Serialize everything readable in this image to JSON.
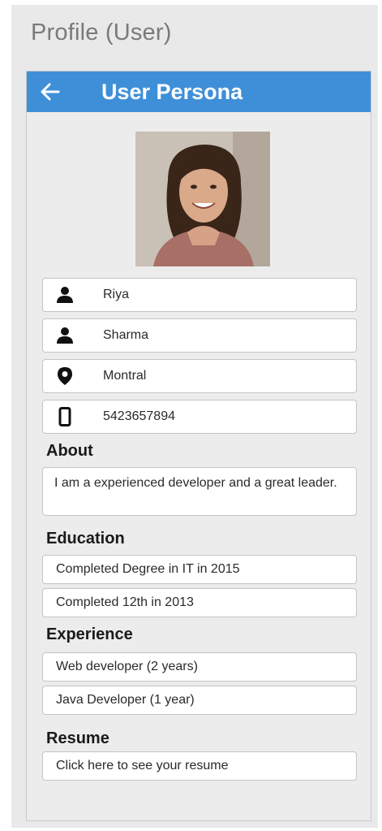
{
  "window": {
    "title": "Profile (User)"
  },
  "appbar": {
    "title": "User Persona",
    "back_icon": "arrow-left-icon"
  },
  "profile": {
    "photo_icon": "user-photo",
    "first_name": "Riya",
    "last_name": "Sharma",
    "location": "Montral",
    "phone": "5423657894"
  },
  "about": {
    "heading": "About",
    "text": "I am a experienced developer and a great leader."
  },
  "education": {
    "heading": "Education",
    "items": [
      "Completed Degree in IT in 2015",
      "Completed 12th in 2013"
    ]
  },
  "experience": {
    "heading": "Experience",
    "items": [
      "Web developer (2 years)",
      "Java Developer (1 year)"
    ]
  },
  "resume": {
    "heading": "Resume",
    "link_text": "Click here to see your resume"
  },
  "colors": {
    "appbar": "#3f8fd8",
    "background": "#ececec",
    "field": "#ffffff"
  }
}
